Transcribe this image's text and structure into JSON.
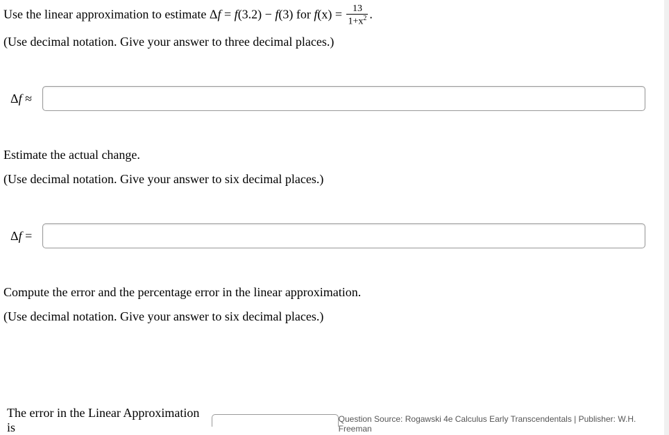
{
  "question": {
    "prompt_prefix": "Use the linear approximation to estimate Δ",
    "prompt_var1": "f",
    "prompt_eq1": " = ",
    "prompt_f32": "f",
    "prompt_paren1": "(3.2) − ",
    "prompt_f3": "f",
    "prompt_paren2": "(3) for ",
    "prompt_fx": "f",
    "prompt_paren3": "(x) = ",
    "fraction_num": "13",
    "fraction_den_prefix": "1+x",
    "fraction_den_sup": "2",
    "prompt_suffix": "."
  },
  "instruction1": "(Use decimal notation. Give your answer to three decimal places.)",
  "answer1_label_prefix": "Δ",
  "answer1_label_var": "f",
  "answer1_label_suffix": " ≈",
  "section2": {
    "heading": "Estimate the actual change.",
    "instruction": "(Use decimal notation. Give your answer to six decimal places.)"
  },
  "answer2_label_prefix": "Δ",
  "answer2_label_var": "f",
  "answer2_label_suffix": " =",
  "section3": {
    "heading": "Compute the error and the percentage error in the linear approximation.",
    "instruction": "(Use decimal notation. Give your answer to six decimal places.)"
  },
  "footer_label": "The error in the Linear Approximation is",
  "source": "Question Source: Rogawski 4e Calculus Early Transcendentals   |   Publisher: W.H. Freeman"
}
